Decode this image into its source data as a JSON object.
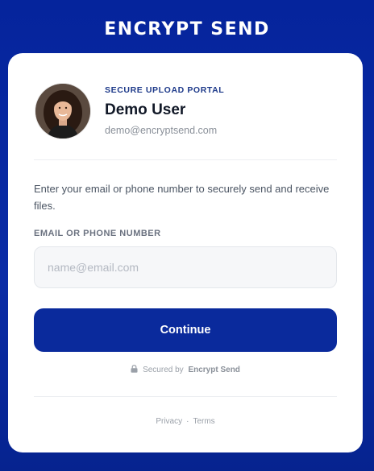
{
  "brand": {
    "title": "ENCRYPT SEND"
  },
  "profile": {
    "portal_label": "SECURE UPLOAD PORTAL",
    "name": "Demo User",
    "email": "demo@encryptsend.com"
  },
  "form": {
    "intro": "Enter your email or phone number to securely send and receive files.",
    "field_label": "EMAIL OR PHONE NUMBER",
    "placeholder": "name@email.com",
    "value": "",
    "submit_label": "Continue"
  },
  "security": {
    "icon": "lock-icon",
    "prefix": "Secured by",
    "brand": "Encrypt Send"
  },
  "footer": {
    "privacy": "Privacy",
    "separator": "·",
    "terms": "Terms"
  },
  "colors": {
    "background": "#05249c",
    "primary_button": "#0a2a9c",
    "accent_text": "#1e3a8a"
  }
}
